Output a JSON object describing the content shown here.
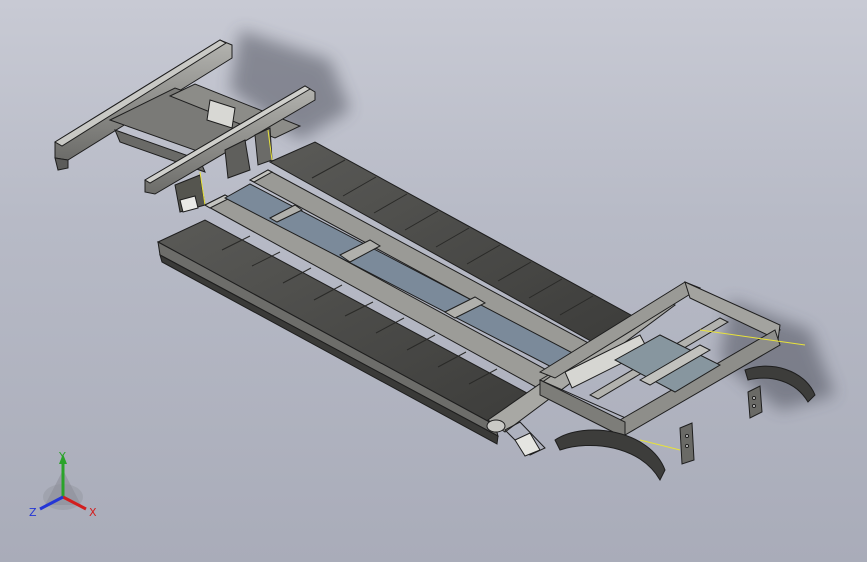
{
  "viewport": {
    "background_top": "#c8cad4",
    "background_bottom": "#a9acb9"
  },
  "model": {
    "panel_color": "#4a4a48",
    "frame_color": "#8e8e8a",
    "edge_color": "#1e1e1e",
    "highlight_color": "#e8e23a"
  },
  "triad": {
    "x_label": "X",
    "y_label": "Y",
    "z_label": "Z",
    "x_color": "#d21e1e",
    "y_color": "#2aa32a",
    "z_color": "#2436d6"
  }
}
